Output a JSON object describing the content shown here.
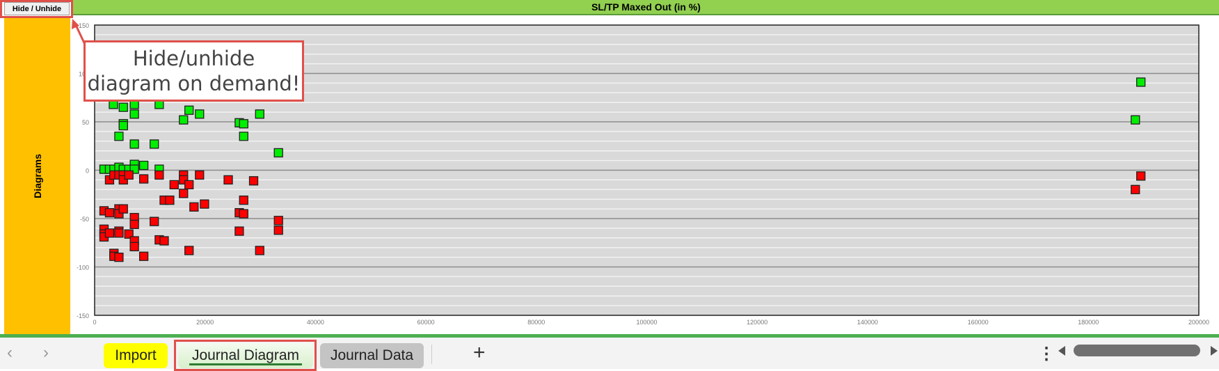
{
  "toolbar": {
    "hide_button_label": "Hide / Unhide"
  },
  "sidebar": {
    "label": "Diagrams"
  },
  "callout": {
    "line1": "Hide/unhide",
    "line2": "diagram on demand!"
  },
  "sheet_tabs": {
    "items": [
      {
        "label": "Import",
        "color": "#ffff00"
      },
      {
        "label": "Journal Diagram",
        "active": true
      },
      {
        "label": "Journal Data",
        "color": "#c4c4c4"
      }
    ],
    "add_label": "+",
    "prev_label": "‹",
    "next_label": "›",
    "more_label": "⋮"
  },
  "colors": {
    "header": "#92d050",
    "sidebar": "#ffc000",
    "profit": "#00ee00",
    "loss": "#ff0000",
    "plot_bg": "#d9d9d9",
    "highlight": "#e0504a"
  },
  "chart_data": {
    "type": "scatter",
    "title": "SL/TP Maxed Out (in %)",
    "xlim": [
      0,
      200000
    ],
    "ylim": [
      -150,
      150
    ],
    "xticks": [
      0,
      20000,
      40000,
      60000,
      80000,
      100000,
      120000,
      140000,
      160000,
      180000,
      200000
    ],
    "xtick_labels": [
      "0",
      "20000",
      "40000",
      "60000",
      "80000",
      "100000",
      "120000",
      "140000",
      "160000",
      "180000",
      "200000"
    ],
    "yticks": [
      -150,
      -100,
      -50,
      0,
      50,
      100,
      150
    ],
    "ytick_labels": [
      "-150",
      "-100",
      "-50",
      "0",
      "50",
      "100",
      "150"
    ],
    "grid": true,
    "series": [
      {
        "color": "#00ee00",
        "points": [
          [
            1700,
            1
          ],
          [
            2700,
            1
          ],
          [
            3500,
            1
          ],
          [
            4400,
            3
          ],
          [
            5200,
            1
          ],
          [
            6200,
            1
          ],
          [
            7200,
            6
          ],
          [
            7200,
            1
          ],
          [
            8900,
            5
          ],
          [
            11700,
            1
          ],
          [
            3400,
            68
          ],
          [
            5200,
            65
          ],
          [
            7200,
            68
          ],
          [
            7200,
            58
          ],
          [
            5200,
            48
          ],
          [
            5200,
            46
          ],
          [
            4400,
            35
          ],
          [
            7200,
            27
          ],
          [
            10800,
            27
          ],
          [
            11700,
            68
          ],
          [
            17100,
            62
          ],
          [
            16100,
            52
          ],
          [
            19000,
            58
          ],
          [
            26200,
            49
          ],
          [
            27000,
            48
          ],
          [
            27000,
            35
          ],
          [
            29900,
            58
          ],
          [
            33300,
            18
          ],
          [
            189500,
            91
          ],
          [
            188500,
            52
          ]
        ]
      },
      {
        "color": "#ff0000",
        "points": [
          [
            2700,
            -10
          ],
          [
            3500,
            -5
          ],
          [
            4400,
            -5
          ],
          [
            5200,
            -5
          ],
          [
            5200,
            -10
          ],
          [
            6200,
            -5
          ],
          [
            8900,
            -9
          ],
          [
            11700,
            -5
          ],
          [
            14400,
            -15
          ],
          [
            16100,
            -5
          ],
          [
            16100,
            -10
          ],
          [
            17100,
            -15
          ],
          [
            19000,
            -5
          ],
          [
            16100,
            -24
          ],
          [
            12600,
            -31
          ],
          [
            13600,
            -31
          ],
          [
            18000,
            -38
          ],
          [
            19900,
            -35
          ],
          [
            24200,
            -10
          ],
          [
            28800,
            -11
          ],
          [
            27000,
            -31
          ],
          [
            1700,
            -42
          ],
          [
            2700,
            -44
          ],
          [
            4400,
            -40
          ],
          [
            4400,
            -45
          ],
          [
            5200,
            -40
          ],
          [
            7200,
            -49
          ],
          [
            7200,
            -56
          ],
          [
            10800,
            -53
          ],
          [
            26200,
            -44
          ],
          [
            27000,
            -45
          ],
          [
            33300,
            -52
          ],
          [
            1700,
            -61
          ],
          [
            1700,
            -66
          ],
          [
            1700,
            -69
          ],
          [
            2700,
            -65
          ],
          [
            4400,
            -63
          ],
          [
            4400,
            -65
          ],
          [
            6200,
            -66
          ],
          [
            7200,
            -73
          ],
          [
            7200,
            -79
          ],
          [
            11700,
            -72
          ],
          [
            12600,
            -73
          ],
          [
            26200,
            -63
          ],
          [
            33300,
            -62
          ],
          [
            17100,
            -83
          ],
          [
            29900,
            -83
          ],
          [
            3500,
            -86
          ],
          [
            3500,
            -89
          ],
          [
            4400,
            -90
          ],
          [
            8900,
            -89
          ],
          [
            188500,
            -20
          ],
          [
            189500,
            -6
          ]
        ]
      }
    ]
  }
}
